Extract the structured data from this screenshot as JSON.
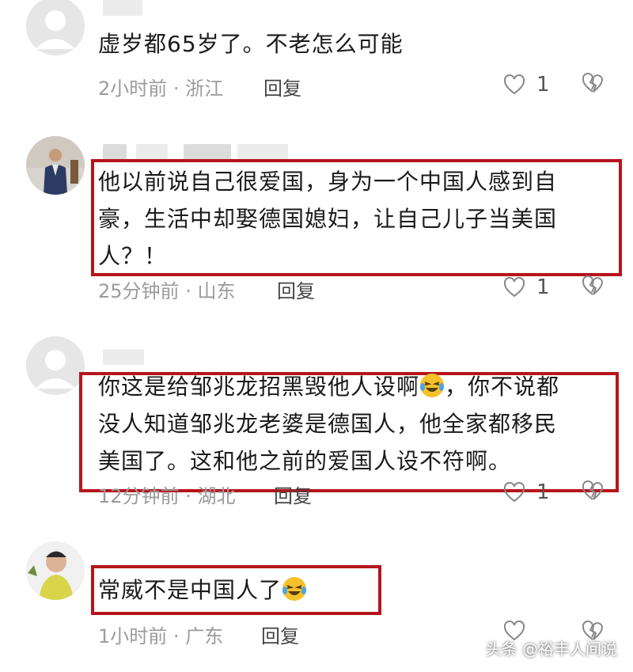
{
  "comments": [
    {
      "text_lines": [
        "虚岁都65岁了。不老怎么可能"
      ],
      "time": "2小时前",
      "location": "浙江",
      "reply_label": "回复",
      "likes": "1"
    },
    {
      "text_lines": [
        "他以前说自己很爱国，身为一个中国人感到自",
        "豪，生活中却娶德国媳妇，让自己儿子当美国",
        "人？！"
      ],
      "time": "25分钟前",
      "location": "山东",
      "reply_label": "回复",
      "likes": "1"
    },
    {
      "text_lines": [
        "你这是给邹兆龙招黑毁他人设啊",
        "，你不说都",
        "没人知道邹兆龙老婆是德国人，他全家都移民",
        "美国了。这和他之前的爱国人设不符啊。"
      ],
      "time": "12分钟前",
      "location": "湖北",
      "reply_label": "回复",
      "likes": "1"
    },
    {
      "text_lines": [
        "常威不是中国人了"
      ],
      "time": "1小时前",
      "location": "广东",
      "reply_label": "回复",
      "likes": ""
    }
  ],
  "meta_separator": "·",
  "watermark": "头条 @裕丰人间说",
  "colors": {
    "highlight_border": "#b5151b",
    "meta_text": "#9b9b9b"
  }
}
